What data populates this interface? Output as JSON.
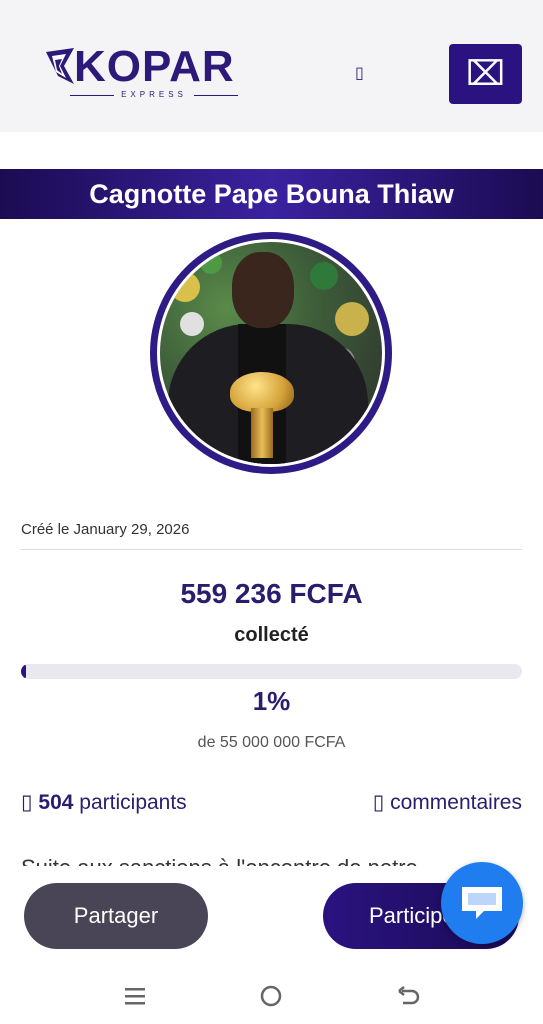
{
  "header": {
    "logo_main": "KOPAR",
    "logo_sub": "EXPRESS",
    "icon_glyph": "▯",
    "menu_glyph": "⌧"
  },
  "campaign": {
    "title": "Cagnotte Pape Bouna Thiaw",
    "created": "Créé le January 29, 2026",
    "amount": "559 236 FCFA",
    "collected_label": "collecté",
    "progress_percent": 1,
    "percent_label": "1%",
    "goal": "de 55 000 000 FCFA",
    "participants_glyph": "▯",
    "participants_count": "504",
    "participants_label": "participants",
    "comments_glyph": "▯",
    "comments_label": "commentaires",
    "description": "Suite aux sanctions à l'encontre de notre"
  },
  "actions": {
    "share_label": "Partager",
    "participate_label": "Participer"
  },
  "colors": {
    "brand": "#2a1380",
    "chat": "#1f7df0"
  }
}
